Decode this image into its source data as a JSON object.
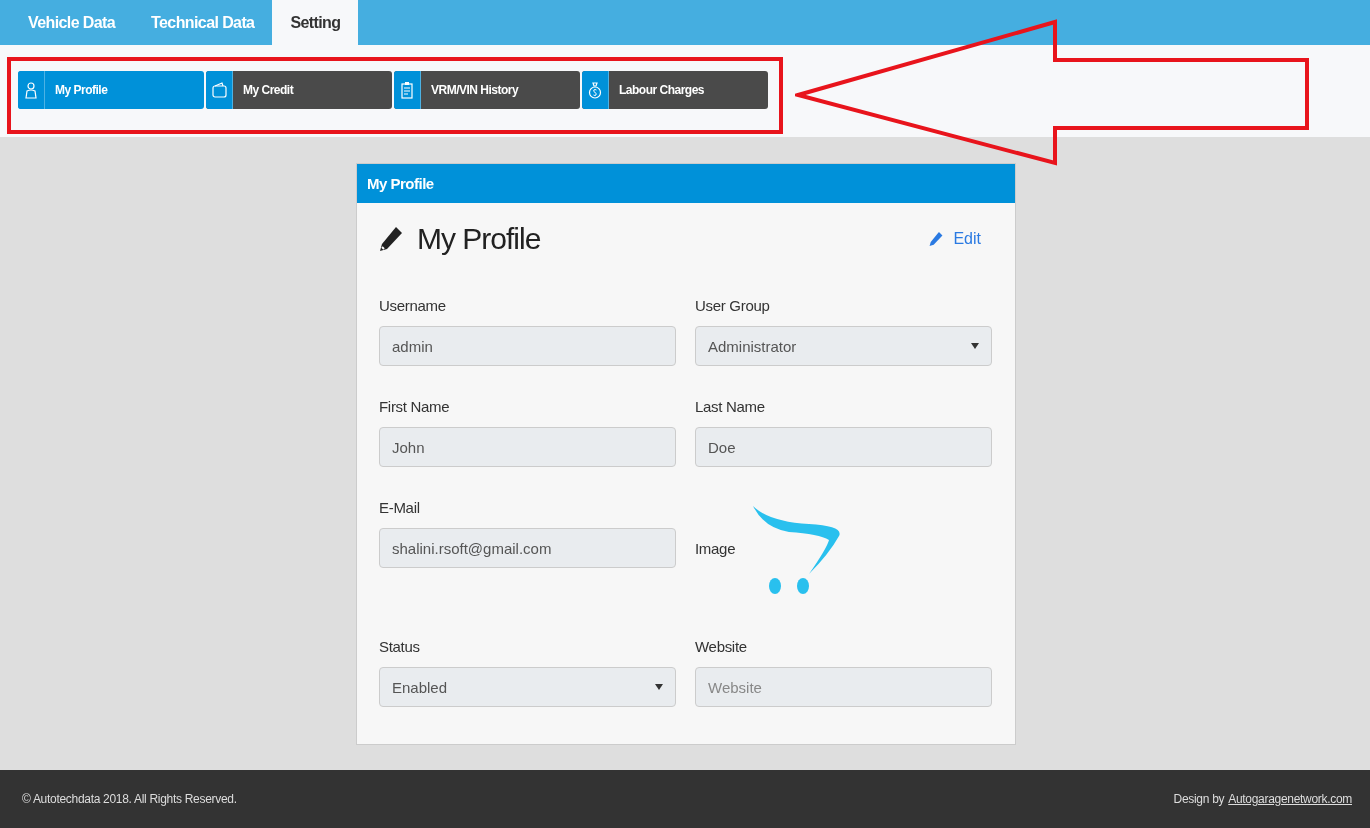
{
  "top_tabs": [
    {
      "label": "Vehicle Data",
      "selected": false
    },
    {
      "label": "Technical Data",
      "selected": false
    },
    {
      "label": "Setting",
      "selected": true
    }
  ],
  "sub_tabs": [
    {
      "label": "My Profile",
      "kind": "person",
      "selected": true
    },
    {
      "label": "My Credit",
      "kind": "wallet",
      "selected": false
    },
    {
      "label": "VRM/VIN History",
      "kind": "clipboard",
      "selected": false
    },
    {
      "label": "Labour Charges",
      "kind": "moneybag",
      "selected": false
    }
  ],
  "card": {
    "header": "My Profile",
    "title": "My Profile",
    "edit_link": "Edit",
    "fields": [
      {
        "label": "Username",
        "kind": "text",
        "value": "admin"
      },
      {
        "label": "User Group",
        "kind": "select",
        "value": "Administrator"
      },
      {
        "label": "First Name",
        "kind": "text",
        "value": "John"
      },
      {
        "label": "Last Name",
        "kind": "text",
        "value": "Doe"
      },
      {
        "label": "E-Mail",
        "kind": "text",
        "value": "shalini.rsoft@gmail.com"
      },
      {
        "label": "Image",
        "kind": "image"
      },
      {
        "label": "Status",
        "kind": "select",
        "value": "Enabled"
      },
      {
        "label": "Website",
        "kind": "text",
        "placeholder": "Website"
      }
    ]
  },
  "footer": {
    "copyright": "© Autotechdata 2018. All Rights Reserved.",
    "design_prefix": "Design by",
    "design_link": "Autogaragenetwork.com"
  }
}
